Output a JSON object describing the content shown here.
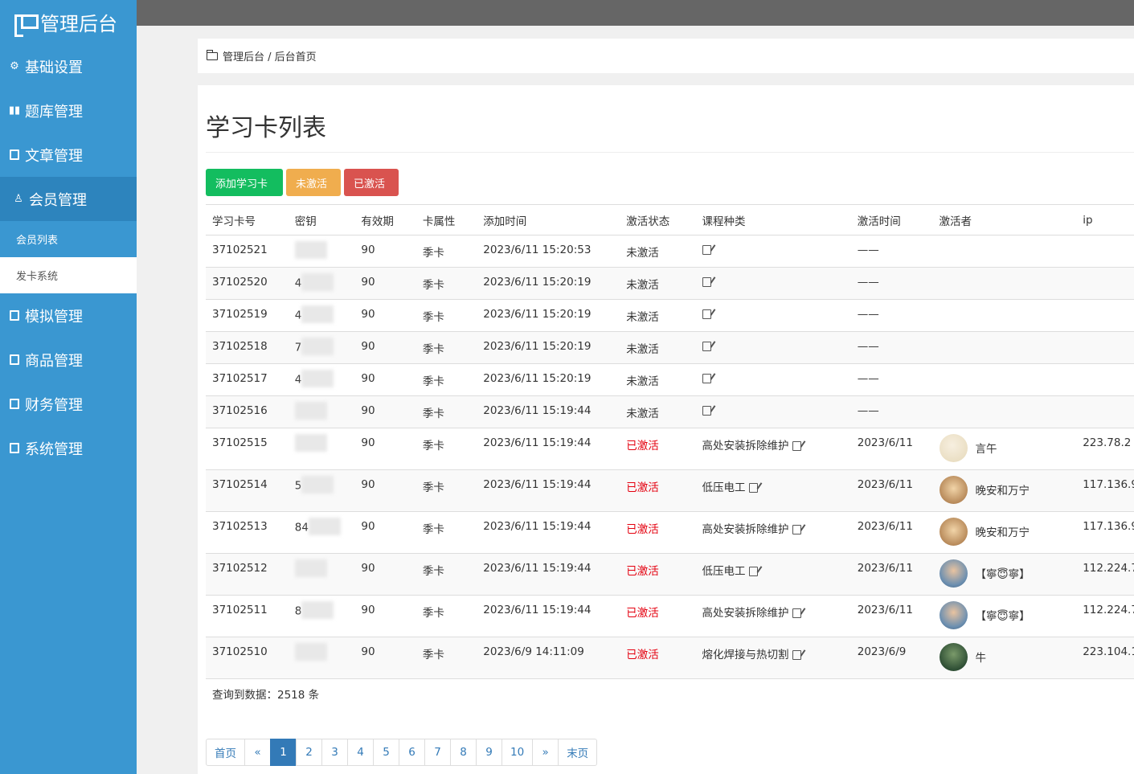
{
  "brand": "管理后台",
  "sidebar": {
    "items": [
      {
        "label": "基础设置",
        "icon": "gear-icon"
      },
      {
        "label": "题库管理",
        "icon": "books-icon"
      },
      {
        "label": "文章管理",
        "icon": "document-icon"
      },
      {
        "label": "会员管理",
        "icon": "user-icon"
      },
      {
        "label": "模拟管理",
        "icon": "exam-icon"
      },
      {
        "label": "商品管理",
        "icon": "goods-icon"
      },
      {
        "label": "财务管理",
        "icon": "finance-icon"
      },
      {
        "label": "系统管理",
        "icon": "system-icon"
      }
    ],
    "sub_items": [
      {
        "label": "会员列表"
      },
      {
        "label": "发卡系统"
      }
    ]
  },
  "breadcrumb": "管理后台 / 后台首页",
  "main": {
    "title": "学习卡列表",
    "buttons": {
      "add": "添加学习卡",
      "inactive": "未激活",
      "active": "已激活"
    },
    "table": {
      "headers": [
        "学习卡号",
        "密钥",
        "有效期",
        "卡属性",
        "添加时间",
        "激活状态",
        "课程种类",
        "激活时间",
        "激活者",
        "ip"
      ],
      "rows": [
        {
          "id": "37102521",
          "key_vis": "",
          "days": "90",
          "type": "季卡",
          "added": "2023/6/11 15:20:53",
          "status": "未激活",
          "course": "",
          "act_time": "——",
          "user": "",
          "ip": ""
        },
        {
          "id": "37102520",
          "key_vis": "4",
          "days": "90",
          "type": "季卡",
          "added": "2023/6/11 15:20:19",
          "status": "未激活",
          "course": "",
          "act_time": "——",
          "user": "",
          "ip": ""
        },
        {
          "id": "37102519",
          "key_vis": "4",
          "days": "90",
          "type": "季卡",
          "added": "2023/6/11 15:20:19",
          "status": "未激活",
          "course": "",
          "act_time": "——",
          "user": "",
          "ip": ""
        },
        {
          "id": "37102518",
          "key_vis": "7",
          "days": "90",
          "type": "季卡",
          "added": "2023/6/11 15:20:19",
          "status": "未激活",
          "course": "",
          "act_time": "——",
          "user": "",
          "ip": ""
        },
        {
          "id": "37102517",
          "key_vis": "4",
          "days": "90",
          "type": "季卡",
          "added": "2023/6/11 15:20:19",
          "status": "未激活",
          "course": "",
          "act_time": "——",
          "user": "",
          "ip": ""
        },
        {
          "id": "37102516",
          "key_vis": "",
          "days": "90",
          "type": "季卡",
          "added": "2023/6/11 15:19:44",
          "status": "未激活",
          "course": "",
          "act_time": "——",
          "user": "",
          "ip": ""
        },
        {
          "id": "37102515",
          "key_vis": "",
          "days": "90",
          "type": "季卡",
          "added": "2023/6/11 15:19:44",
          "status": "已激活",
          "course": "高处安装拆除维护",
          "act_time": "2023/6/11",
          "user": "言午",
          "ip": "223.78.2"
        },
        {
          "id": "37102514",
          "key_vis": "5",
          "days": "90",
          "type": "季卡",
          "added": "2023/6/11 15:19:44",
          "status": "已激活",
          "course": "低压电工",
          "act_time": "2023/6/11",
          "user": "晚安和万宁",
          "ip": "117.136.9"
        },
        {
          "id": "37102513",
          "key_vis": "84",
          "days": "90",
          "type": "季卡",
          "added": "2023/6/11 15:19:44",
          "status": "已激活",
          "course": "高处安装拆除维护",
          "act_time": "2023/6/11",
          "user": "晚安和万宁",
          "ip": "117.136.9"
        },
        {
          "id": "37102512",
          "key_vis": "",
          "days": "90",
          "type": "季卡",
          "added": "2023/6/11 15:19:44",
          "status": "已激活",
          "course": "低压电工",
          "act_time": "2023/6/11",
          "user": "【寧😇寧】",
          "ip": "112.224.7"
        },
        {
          "id": "37102511",
          "key_vis": "8",
          "days": "90",
          "type": "季卡",
          "added": "2023/6/11 15:19:44",
          "status": "已激活",
          "course": "高处安装拆除维护",
          "act_time": "2023/6/11",
          "user": "【寧😇寧】",
          "ip": "112.224.7"
        },
        {
          "id": "37102510",
          "key_vis": "",
          "days": "90",
          "type": "季卡",
          "added": "2023/6/9 14:11:09",
          "status": "已激活",
          "course": "熔化焊接与热切割",
          "act_time": "2023/6/9",
          "user": "牛",
          "ip": "223.104.1"
        }
      ]
    },
    "summary": "查询到数据：2518 条",
    "pagination": [
      "首页",
      "«",
      "1",
      "2",
      "3",
      "4",
      "5",
      "6",
      "7",
      "8",
      "9",
      "10",
      "»",
      "末页"
    ],
    "colors": {
      "sidebar": "#3a97d1",
      "active_nav": "#2d84bd",
      "green": "#13bd5f",
      "orange": "#f0ad4e",
      "red": "#d9534f",
      "link": "#337ab7"
    }
  }
}
